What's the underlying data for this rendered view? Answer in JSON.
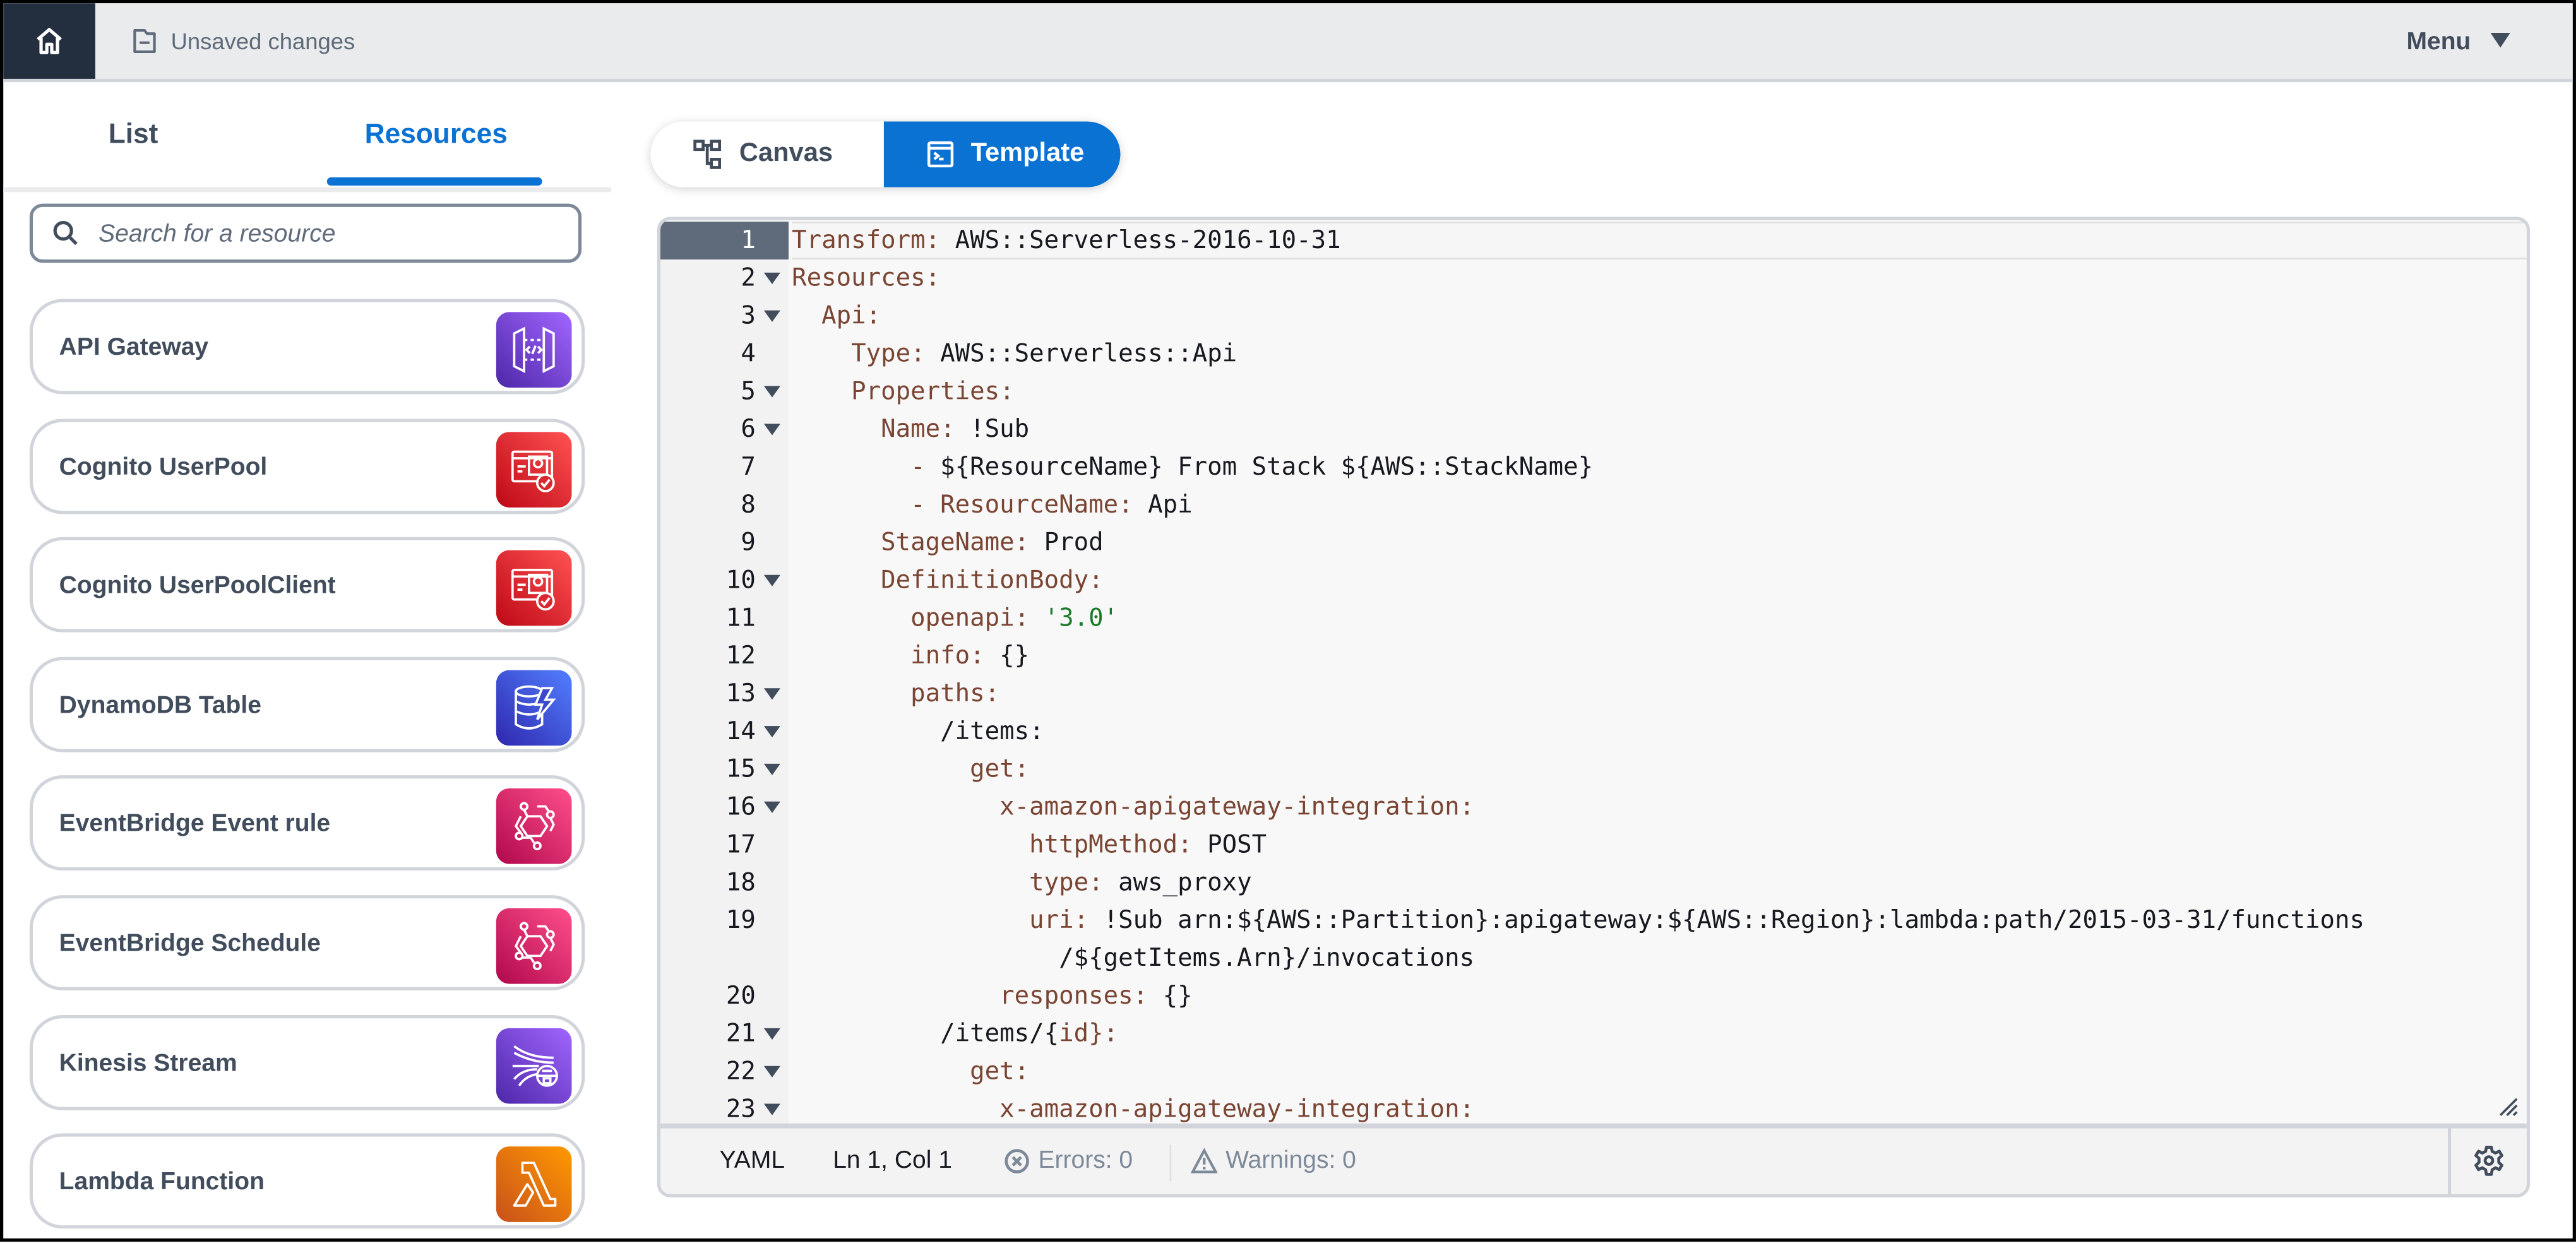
{
  "topbar": {
    "status_text": "Unsaved changes",
    "menu_label": "Menu"
  },
  "left_panel": {
    "tabs": [
      {
        "label": "List",
        "active": false
      },
      {
        "label": "Resources",
        "active": true
      }
    ],
    "search": {
      "placeholder": "Search for a resource",
      "value": ""
    },
    "resources": [
      {
        "label": "API Gateway",
        "icon": "api-gateway-icon",
        "color": "#6b3fc9"
      },
      {
        "label": "Cognito UserPool",
        "icon": "cognito-icon",
        "color": "#d9282f"
      },
      {
        "label": "Cognito UserPoolClient",
        "icon": "cognito-icon",
        "color": "#d9282f"
      },
      {
        "label": "DynamoDB Table",
        "icon": "dynamodb-icon",
        "color": "#3b48cc"
      },
      {
        "label": "EventBridge Event rule",
        "icon": "eventbridge-icon",
        "color": "#d6245f"
      },
      {
        "label": "EventBridge Schedule",
        "icon": "eventbridge-icon",
        "color": "#d6245f"
      },
      {
        "label": "Kinesis Stream",
        "icon": "kinesis-icon",
        "color": "#7a47d6"
      },
      {
        "label": "Lambda Function",
        "icon": "lambda-icon",
        "color": "#e8730f"
      }
    ]
  },
  "view_toggle": {
    "options": [
      {
        "label": "Canvas",
        "active": false
      },
      {
        "label": "Template",
        "active": true
      }
    ]
  },
  "editor": {
    "language": "YAML",
    "cursor_position": "Ln 1, Col 1",
    "errors_label": "Errors: 0",
    "warnings_label": "Warnings: 0",
    "active_line": 1,
    "lines": [
      {
        "n": "1",
        "fold": false,
        "indent": 0,
        "key": "Transform:",
        "val": " AWS::Serverless-2016-10-31"
      },
      {
        "n": "2",
        "fold": true,
        "indent": 0,
        "key": "Resources:",
        "val": ""
      },
      {
        "n": "3",
        "fold": true,
        "indent": 2,
        "key": "Api:",
        "val": ""
      },
      {
        "n": "4",
        "fold": false,
        "indent": 4,
        "key": "Type:",
        "val": " AWS::Serverless::Api"
      },
      {
        "n": "5",
        "fold": true,
        "indent": 4,
        "key": "Properties:",
        "val": ""
      },
      {
        "n": "6",
        "fold": true,
        "indent": 6,
        "key": "Name:",
        "val": " !Sub"
      },
      {
        "n": "7",
        "fold": false,
        "indent": 8,
        "key": "- ",
        "val": "${ResourceName} From Stack ${AWS::StackName}"
      },
      {
        "n": "8",
        "fold": false,
        "indent": 8,
        "key": "- ResourceName:",
        "val": " Api"
      },
      {
        "n": "9",
        "fold": false,
        "indent": 6,
        "key": "StageName:",
        "val": " Prod"
      },
      {
        "n": "10",
        "fold": true,
        "indent": 6,
        "key": "DefinitionBody:",
        "val": ""
      },
      {
        "n": "11",
        "fold": false,
        "indent": 8,
        "key": "openapi:",
        "val": "",
        "str": " '3.0'"
      },
      {
        "n": "12",
        "fold": false,
        "indent": 8,
        "key": "info:",
        "val": " {}"
      },
      {
        "n": "13",
        "fold": true,
        "indent": 8,
        "key": "paths:",
        "val": ""
      },
      {
        "n": "14",
        "fold": true,
        "indent": 10,
        "key": "",
        "val": "/items:"
      },
      {
        "n": "15",
        "fold": true,
        "indent": 12,
        "key": "get:",
        "val": ""
      },
      {
        "n": "16",
        "fold": true,
        "indent": 14,
        "key": "x-amazon-apigateway-integration:",
        "val": ""
      },
      {
        "n": "17",
        "fold": false,
        "indent": 16,
        "key": "httpMethod:",
        "val": " POST"
      },
      {
        "n": "18",
        "fold": false,
        "indent": 16,
        "key": "type:",
        "val": " aws_proxy"
      },
      {
        "n": "19",
        "fold": false,
        "indent": 16,
        "key": "uri:",
        "val": " !Sub arn:${AWS::Partition}:apigateway:${AWS::Region}:lambda:path/2015-03-31/functions"
      },
      {
        "n": "",
        "fold": false,
        "indent": 18,
        "key": "",
        "val": "/${getItems.Arn}/invocations"
      },
      {
        "n": "20",
        "fold": false,
        "indent": 14,
        "key": "responses:",
        "val": " {}"
      },
      {
        "n": "21",
        "fold": true,
        "indent": 10,
        "key": "",
        "val": "/items/{",
        "key2": "id",
        "val2": "}:"
      },
      {
        "n": "22",
        "fold": true,
        "indent": 12,
        "key": "get:",
        "val": ""
      },
      {
        "n": "23",
        "fold": true,
        "indent": 14,
        "key": "x-amazon-apigateway-integration:",
        "val": ""
      }
    ]
  },
  "colors": {
    "accent": "#0972d3",
    "topbar_bg": "#e9ebed",
    "home_bg": "#232f3e",
    "yaml_key": "#7a4533",
    "yaml_string": "#1d7a2a"
  }
}
